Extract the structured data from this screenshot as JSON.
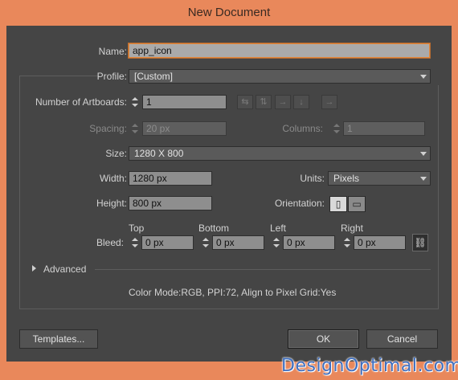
{
  "window": {
    "title": "New Document"
  },
  "name": {
    "label": "Name:",
    "value": "app_icon"
  },
  "profile": {
    "label": "Profile:",
    "value": "[Custom]"
  },
  "artboards": {
    "label": "Number of Artboards:",
    "value": "1"
  },
  "spacing": {
    "label": "Spacing:",
    "value": "20 px"
  },
  "columns": {
    "label": "Columns:",
    "value": "1"
  },
  "size": {
    "label": "Size:",
    "value": "1280 X 800"
  },
  "width": {
    "label": "Width:",
    "value": "1280 px"
  },
  "units": {
    "label": "Units:",
    "value": "Pixels"
  },
  "height": {
    "label": "Height:",
    "value": "800 px"
  },
  "orientation": {
    "label": "Orientation:"
  },
  "bleed": {
    "label": "Bleed:",
    "top": {
      "label": "Top",
      "value": "0 px"
    },
    "bottom": {
      "label": "Bottom",
      "value": "0 px"
    },
    "left": {
      "label": "Left",
      "value": "0 px"
    },
    "right": {
      "label": "Right",
      "value": "0 px"
    }
  },
  "advanced": {
    "label": "Advanced"
  },
  "info": "Color Mode:RGB, PPI:72, Align to Pixel Grid:Yes",
  "buttons": {
    "templates": "Templates...",
    "ok": "OK",
    "cancel": "Cancel"
  },
  "watermark": "DesignOptimal.com",
  "colors": {
    "titlebar": "#e9885b",
    "panel": "#454545",
    "focus": "#e0883d"
  }
}
